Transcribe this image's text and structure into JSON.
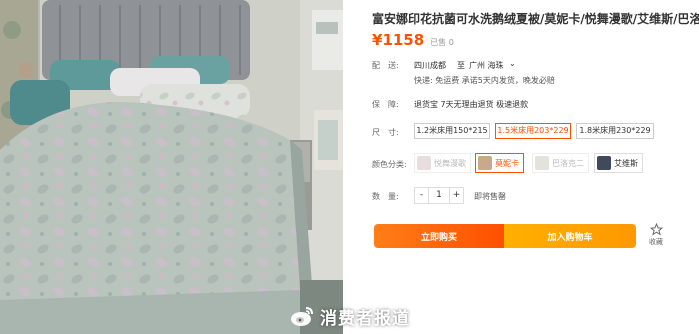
{
  "product": {
    "title": "富安娜印花抗菌可水洗鹅绒夏被/莫妮卡/悦舞漫歌/艾维斯/巴洛克二",
    "currency": "¥",
    "price": "1158",
    "sold": "已售 0"
  },
  "delivery": {
    "label": "配　送:",
    "origin": "四川成都",
    "to": "至",
    "destination": "广州 海珠",
    "chevron": "chevron-down-icon",
    "note": "快递: 免运费  承诺5天内发货，晚发必赔"
  },
  "guarantee": {
    "label": "保　障:",
    "text": "退货宝 7天无理由退货 极速退款"
  },
  "sizes": {
    "label": "尺　寸:",
    "options": [
      "1.2米床用150*215",
      "1.5米床用203*229",
      "1.8米床用230*229"
    ],
    "selected_index": 1
  },
  "colors": {
    "label": "颜色分类:",
    "options": [
      {
        "name": "悦舞漫歌",
        "swatch": "#e8dede",
        "state": "faded"
      },
      {
        "name": "莫妮卡",
        "swatch": "#c9a98a",
        "state": "selected"
      },
      {
        "name": "巴洛克二",
        "swatch": "#e4e2dc",
        "state": "faded"
      },
      {
        "name": "艾维斯",
        "swatch": "#3f4a5c",
        "state": "normal"
      }
    ]
  },
  "quantity": {
    "label": "数　量:",
    "minus": "-",
    "value": "1",
    "plus": "+",
    "stock": "即将售罄"
  },
  "actions": {
    "buy_now": "立即购买",
    "add_cart": "加入购物车",
    "favorite": "收藏",
    "favorite_icon": "star-icon"
  },
  "watermark": {
    "text": "消费者报道",
    "icon": "weibo-logo"
  },
  "colors_theme": {
    "accent": "#ff5000",
    "buy_start": "#ff7e18",
    "cart": "#ffa200"
  }
}
